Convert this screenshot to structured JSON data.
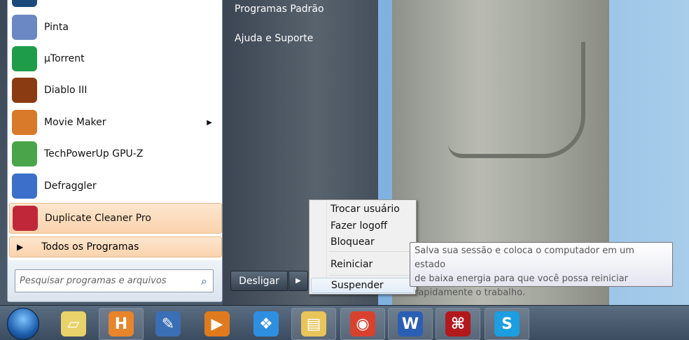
{
  "programs": [
    {
      "label": "Pinta",
      "icon": "pinta-icon",
      "color": "#6b88c4"
    },
    {
      "label": "µTorrent",
      "icon": "utorrent-icon",
      "color": "#1f9c4a"
    },
    {
      "label": "Diablo III",
      "icon": "diablo-icon",
      "color": "#8a3b12"
    },
    {
      "label": "Movie Maker",
      "icon": "movie-maker-icon",
      "color": "#d97a2a",
      "submenu": "▶"
    },
    {
      "label": "TechPowerUp GPU-Z",
      "icon": "gpuz-icon",
      "color": "#4aa54a"
    },
    {
      "label": "Defraggler",
      "icon": "defraggler-icon",
      "color": "#3b6fc9"
    },
    {
      "label": "Duplicate Cleaner Pro",
      "icon": "duplicate-cleaner-icon",
      "color": "#c0283a"
    }
  ],
  "all_programs": "Todos os Programas",
  "all_programs_arrow": "▶",
  "search": {
    "placeholder": "Pesquisar programas e arquivos",
    "icon": "⌕"
  },
  "right_links": [
    "Programas Padrão",
    "Ajuda e Suporte"
  ],
  "shutdown": {
    "label": "Desligar",
    "arrow": "▶"
  },
  "power_menu": [
    "Trocar usuário",
    "Fazer logoff",
    "Bloquear",
    "Reiniciar",
    "Suspender"
  ],
  "tooltip": [
    "Salva sua sessão e coloca o computador em um estado",
    "de baixa energia para que você possa reiniciar",
    "rapidamente o trabalho."
  ],
  "taskbar": [
    {
      "name": "sticky-notes",
      "glyph": "▱",
      "color": "#e8d36a"
    },
    {
      "name": "h-app",
      "glyph": "H",
      "color": "#e8842a"
    },
    {
      "name": "scanner",
      "glyph": "✎",
      "color": "#3a6fb5"
    },
    {
      "name": "media-player",
      "glyph": "▶",
      "color": "#e07a1f"
    },
    {
      "name": "dropbox",
      "glyph": "❖",
      "color": "#2e8fe0"
    },
    {
      "name": "explorer",
      "glyph": "▤",
      "color": "#e8c45a"
    },
    {
      "name": "chrome",
      "glyph": "◉",
      "color": "#d9412f"
    },
    {
      "name": "word",
      "glyph": "W",
      "color": "#2b5fb3"
    },
    {
      "name": "acrobat",
      "glyph": "⌘",
      "color": "#b3181c"
    },
    {
      "name": "skype",
      "glyph": "S",
      "color": "#1c9ee0"
    }
  ]
}
